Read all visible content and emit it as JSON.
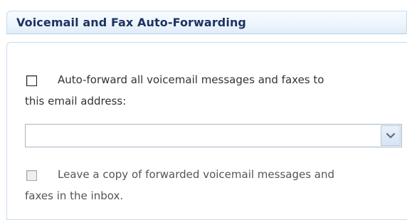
{
  "voicemail_forwarding": {
    "title": "Voicemail and Fax Auto-Forwarding",
    "auto_forward": {
      "checked": false,
      "label_line1": "Auto-forward all voicemail messages and faxes to",
      "label_line2": "this email address:"
    },
    "email_select": {
      "selected_value": "",
      "icon": "chevron-down-icon"
    },
    "leave_copy": {
      "checked": false,
      "enabled": false,
      "label_line1": "Leave a copy of forwarded voicemail messages and",
      "label_line2": "faxes in the inbox."
    }
  }
}
